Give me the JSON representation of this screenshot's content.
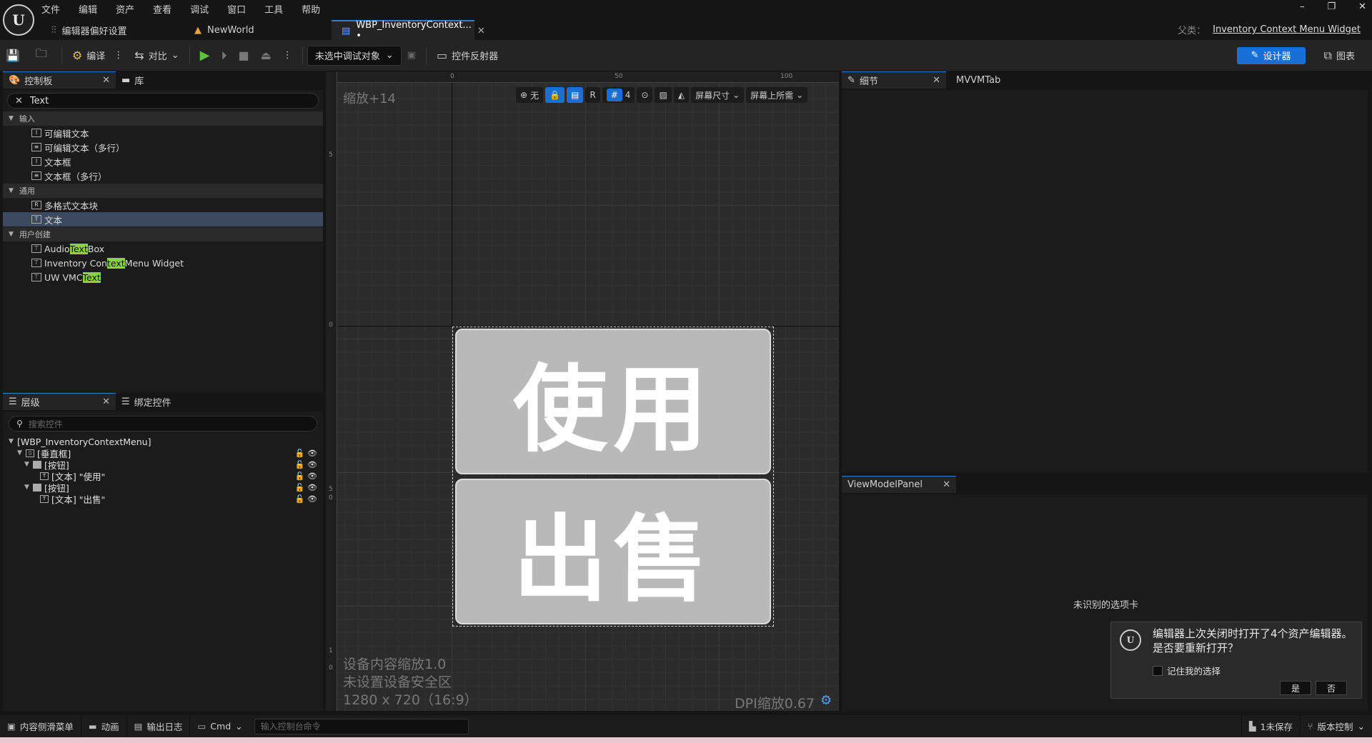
{
  "app": {
    "logo": "U",
    "menu": [
      "文件",
      "编辑",
      "资产",
      "查看",
      "调试",
      "窗口",
      "工具",
      "帮助"
    ],
    "tabs": [
      {
        "label": "编辑器偏好设置",
        "icon": "sliders-icon"
      },
      {
        "label": "NewWorld",
        "icon": "level-icon"
      },
      {
        "label": "WBP_InventoryContext... •",
        "icon": "widget-blueprint-icon"
      }
    ],
    "window_controls": [
      "–",
      "❐",
      "✕"
    ],
    "parent_class_label": "父类：",
    "parent_class_value": "Inventory Context Menu Widget"
  },
  "toolbar": {
    "compile": "编译",
    "diff": "对比",
    "debug_target": "未选中调试对象",
    "widget_reflector": "控件反射器",
    "designer": "设计器",
    "graph": "图表"
  },
  "palette": {
    "tab_palette": "控制板",
    "tab_library": "库",
    "search_value": "Text",
    "categories": [
      {
        "label": "输入",
        "items": [
          "可编辑文本",
          "可编辑文本（多行）",
          "文本框",
          "文本框（多行）"
        ]
      },
      {
        "label": "通用",
        "items": [
          "多格式文本块",
          "文本"
        ]
      },
      {
        "label": "用户创建",
        "items": [
          "Audio Text Box",
          "Inventory Context Menu Widget",
          "UW VMC Text"
        ]
      }
    ],
    "user_items": [
      {
        "pre": "Audio ",
        "hl": "Text",
        "post": " Box"
      },
      {
        "pre": "Inventory Con",
        "hl": "text",
        "post": " Menu Widget"
      },
      {
        "pre": "UW VMC",
        "hl": "Text",
        "post": ""
      }
    ]
  },
  "hierarchy": {
    "tab_hierarchy": "层级",
    "tab_bind": "绑定控件",
    "search_placeholder": "搜索控件",
    "root": "[WBP_InventoryContextMenu]",
    "rows": [
      "[垂直框]",
      "[按钮]",
      "[文本] \"使用\"",
      "[按钮]",
      "[文本] \"出售\""
    ]
  },
  "canvas": {
    "zoom": "缩放+14",
    "ruler_top": [
      "0",
      "50",
      "100"
    ],
    "ruler_left": [
      "5",
      "0",
      "5",
      "0",
      "1",
      "0"
    ],
    "tools": {
      "none": "无",
      "r": "R",
      "grid": "4",
      "screen_size": "屏幕尺寸",
      "fill_screen": "屏幕上所需"
    },
    "button_use": "使用",
    "button_sell": "出售",
    "info_1": "设备内容缩放1.0",
    "info_2": "未设置设备安全区",
    "info_3": "1280 x 720（16:9）",
    "dpi": "DPI缩放0.67"
  },
  "details": {
    "tab_details": "细节",
    "tab_mvvm": "MVVMTab"
  },
  "viewmodel": {
    "tab": "ViewModelPanel",
    "unrecognized": "未识别的选项卡"
  },
  "notification": {
    "message": "编辑器上次关闭时打开了4个资产编辑器。是否要重新打开？",
    "remember": "记住我的选择",
    "yes": "是",
    "no": "否"
  },
  "statusbar": {
    "content_drawer": "内容侧滑菜单",
    "animation": "动画",
    "output_log": "输出日志",
    "cmd": "Cmd",
    "console_placeholder": "输入控制台命令",
    "unsaved": "1未保存",
    "source_control": "版本控制"
  }
}
